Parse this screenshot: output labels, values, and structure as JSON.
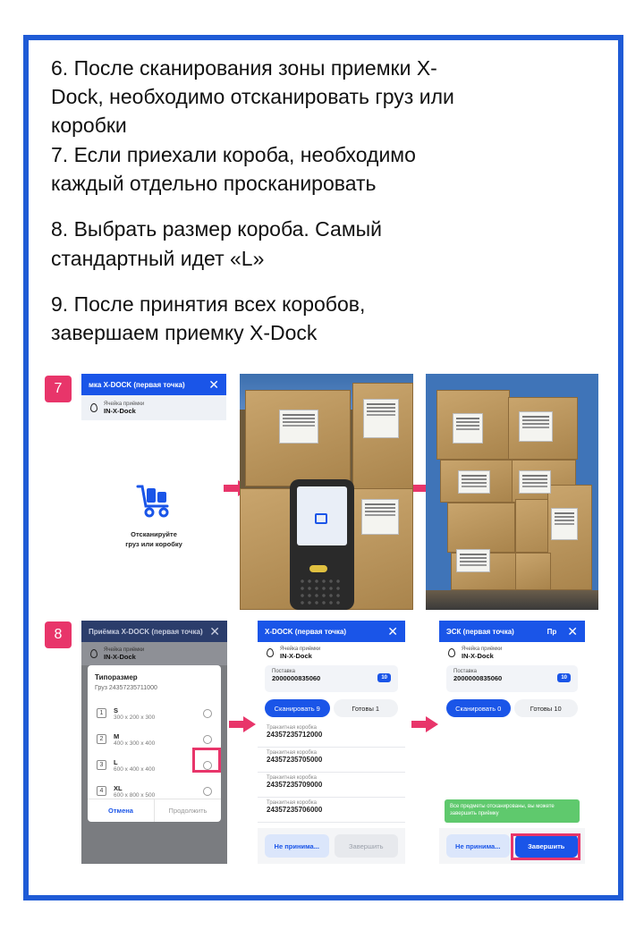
{
  "instructions": {
    "l1": "6. После сканирования зоны приемки X-",
    "l2": "Dock, необходимо отсканировать груз или",
    "l3": "коробки",
    "l4": "7. Если приехали короба, необходимо",
    "l5": "каждый отдельно просканировать",
    "l6": "8. Выбрать размер короба. Самый",
    "l7": "стандартный идет «L»",
    "l8": "9. После принятия всех коробов,",
    "l9": "завершаем приемку X-Dock"
  },
  "badges": {
    "step7": "7",
    "step8": "8"
  },
  "screen1": {
    "title": "мка X-DOCK (первая точка)",
    "close": "✕",
    "cell_label": "Ячейка приёмки",
    "cell_value": "IN-X-Dock",
    "scan_line1": "Отсканируйте",
    "scan_line2": "груз или коробку"
  },
  "screen2": {
    "title": "Приёмка X-DOCK (первая точка)",
    "close": "✕",
    "cell_label": "Ячейка приёмки",
    "cell_value": "IN-X-Dock",
    "dialog_title": "Типоразмер",
    "dialog_sub": "Груз 24357235711000",
    "options": [
      {
        "num": "1",
        "name": "S",
        "size": "300 x 200 x 300"
      },
      {
        "num": "2",
        "name": "M",
        "size": "400 x 300 x 400"
      },
      {
        "num": "3",
        "name": "L",
        "size": "600 x 400 x 400"
      },
      {
        "num": "4",
        "name": "XL",
        "size": "600 x 800 x 500"
      }
    ],
    "cancel": "Отмена",
    "continue": "Продолжить"
  },
  "screen3": {
    "title": "X-DOCK (первая точка)",
    "close": "✕",
    "cell_label": "Ячейка приёмки",
    "cell_value": "IN-X-Dock",
    "supply_label": "Поставка",
    "supply_value": "2000000835060",
    "supply_badge": "10",
    "tab_scan": "Сканировать 9",
    "tab_ready": "Готовы 1",
    "rows": [
      {
        "label": "Транзитная коробка",
        "value": "24357235712000"
      },
      {
        "label": "Транзитная коробка",
        "value": "24357235705000"
      },
      {
        "label": "Транзитная коробка",
        "value": "24357235709000"
      },
      {
        "label": "Транзитная коробка",
        "value": "24357235706000"
      }
    ],
    "btn_reject": "Не принима...",
    "btn_finish": "Завершить"
  },
  "screen4": {
    "title": "ЭСК (первая точка)",
    "title_right": "Пр",
    "close": "✕",
    "cell_label": "Ячейка приёмки",
    "cell_value": "IN-X-Dock",
    "supply_label": "Поставка",
    "supply_value": "2000000835060",
    "supply_badge": "10",
    "tab_scan": "Сканировать 0",
    "tab_ready": "Готовы 10",
    "notice": "Все предметы отсканированы, вы можете завершить приёмку",
    "btn_reject": "Не принима...",
    "btn_finish": "Завершить"
  },
  "colors": {
    "accent": "#1a55e8",
    "highlight": "#e8356a",
    "frame": "#1f5bd6",
    "notice": "#5fc96d"
  }
}
